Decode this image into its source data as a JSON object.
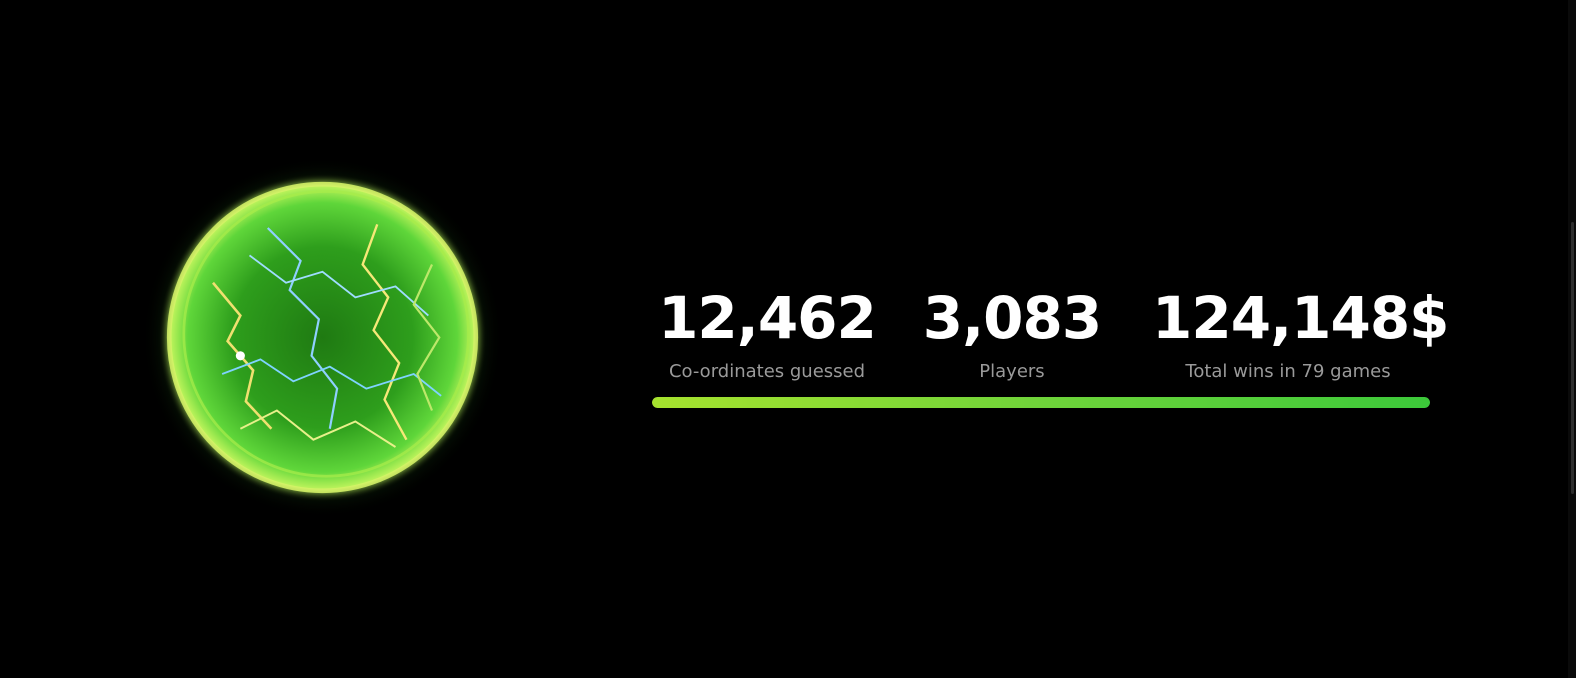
{
  "stats": [
    {
      "value": "12,462",
      "label": "Co-ordinates guessed"
    },
    {
      "value": "3,083",
      "label": "Players"
    },
    {
      "value": "124,148$",
      "label": "Total wins in 79 games"
    }
  ],
  "progress": {
    "fraction": 1.0
  },
  "colors": {
    "background": "#000000",
    "value_text": "#ffffff",
    "label_text": "#9a9a9a",
    "accent_start": "#a6e22e",
    "accent_end": "#3cc93a",
    "orb_core": "#2e9e1c"
  },
  "icons": {
    "orb": "energy-orb-icon"
  }
}
